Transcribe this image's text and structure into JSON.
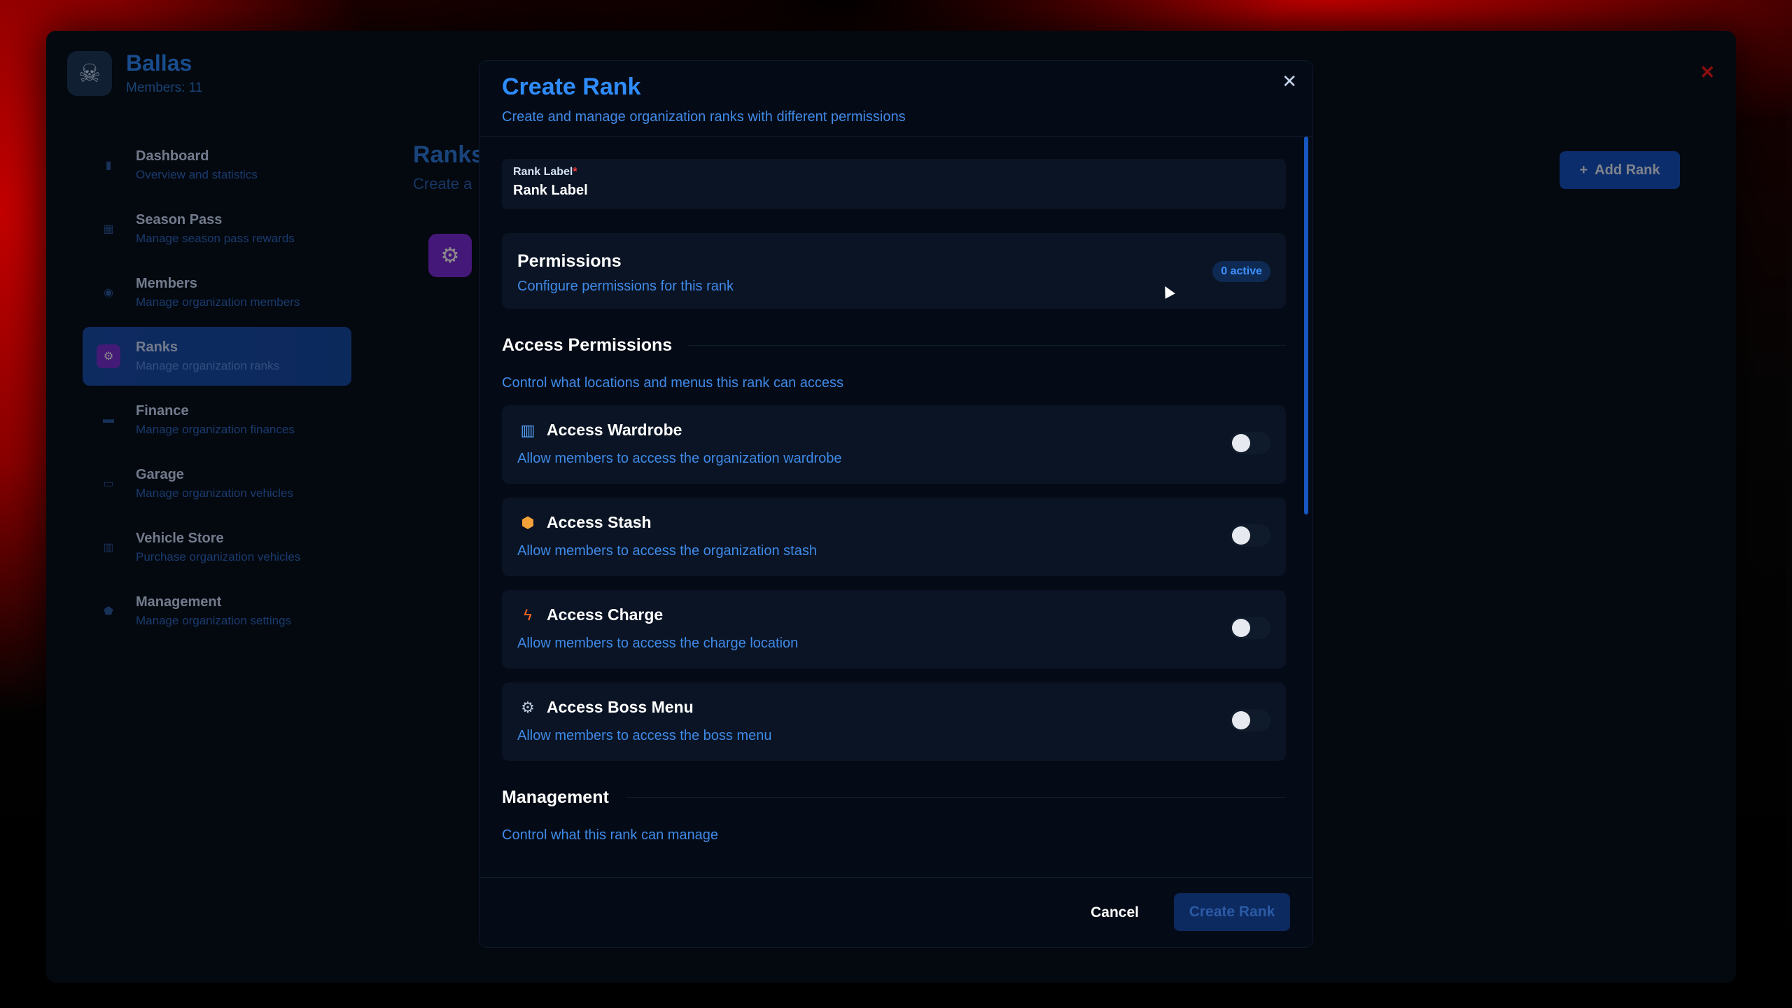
{
  "organization": {
    "name": "Ballas",
    "members_label": "Members: 11",
    "logo_icon": "skull-icon"
  },
  "sidebar": {
    "items": [
      {
        "label": "Dashboard",
        "sub": "Overview and statistics",
        "icon": "chart-icon"
      },
      {
        "label": "Season Pass",
        "sub": "Manage season pass rewards",
        "icon": "grid-icon"
      },
      {
        "label": "Members",
        "sub": "Manage organization members",
        "icon": "users-icon"
      },
      {
        "label": "Ranks",
        "sub": "Manage organization ranks",
        "icon": "gear-icon",
        "active": true
      },
      {
        "label": "Finance",
        "sub": "Manage organization finances",
        "icon": "wallet-icon"
      },
      {
        "label": "Garage",
        "sub": "Manage organization vehicles",
        "icon": "car-icon"
      },
      {
        "label": "Vehicle Store",
        "sub": "Purchase organization vehicles",
        "icon": "store-icon"
      },
      {
        "label": "Management",
        "sub": "Manage organization settings",
        "icon": "shield-icon"
      }
    ]
  },
  "page": {
    "title": "Ranks",
    "subtitle": "Create a",
    "add_button": "Add Rank"
  },
  "modal": {
    "title": "Create Rank",
    "subtitle": "Create and manage organization ranks with different permissions",
    "rank_field": {
      "label": "Rank Label",
      "required_mark": "*",
      "value": "Rank Label"
    },
    "permissions": {
      "title": "Permissions",
      "subtitle": "Configure permissions for this rank",
      "badge": "0 active"
    },
    "access_section": {
      "title": "Access Permissions",
      "subtitle": "Control what locations and menus this rank can access",
      "items": [
        {
          "label": "Access Wardrobe",
          "sub": "Allow members to access the organization wardrobe",
          "icon": "wardrobe-icon",
          "enabled": false
        },
        {
          "label": "Access Stash",
          "sub": "Allow members to access the organization stash",
          "icon": "box-icon",
          "enabled": false
        },
        {
          "label": "Access Charge",
          "sub": "Allow members to access the charge location",
          "icon": "lightning-icon",
          "enabled": false
        },
        {
          "label": "Access Boss Menu",
          "sub": "Allow members to access the boss menu",
          "icon": "gear-icon",
          "enabled": false
        }
      ]
    },
    "management_section": {
      "title": "Management",
      "subtitle": "Control what this rank can manage"
    },
    "footer": {
      "cancel": "Cancel",
      "create": "Create Rank"
    }
  },
  "colors": {
    "accent": "#2f8cff",
    "active_nav": "#1a4fb0",
    "rank_icon": "#7d2ddb",
    "close_red": "#ff1a1a"
  }
}
